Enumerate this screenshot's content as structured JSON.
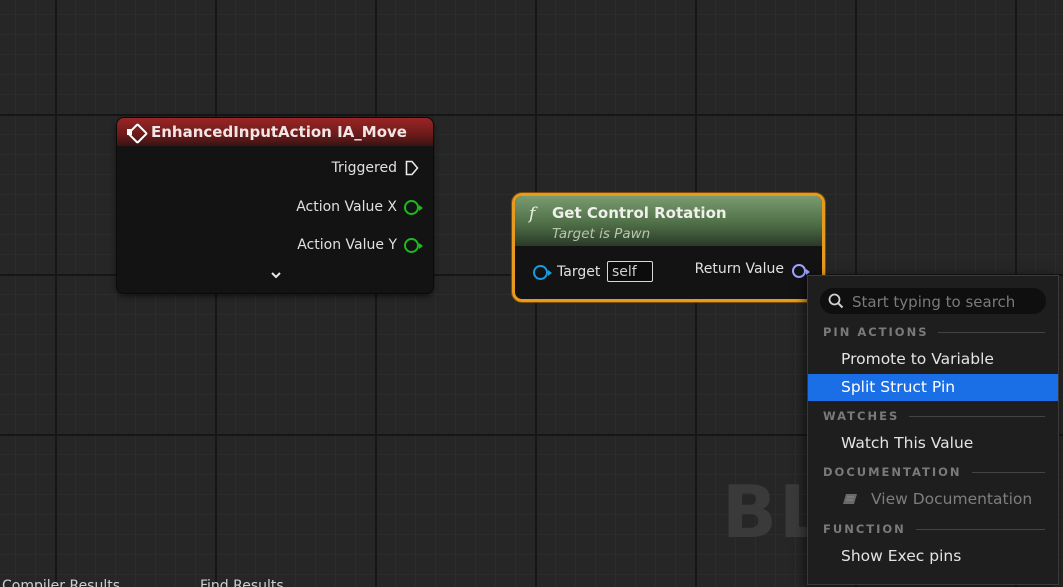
{
  "watermark": "BL",
  "node_input": {
    "title": "EnhancedInputAction IA_Move",
    "pins": [
      "Triggered",
      "Action Value X",
      "Action Value Y"
    ]
  },
  "node_fn": {
    "icon": "f",
    "title": "Get Control Rotation",
    "subtitle": "Target is Pawn",
    "target_label": "Target",
    "target_value": "self",
    "return_label": "Return Value"
  },
  "menu": {
    "search_placeholder": "Start typing to search",
    "sections": {
      "pin_actions": "PIN ACTIONS",
      "watches": "WATCHES",
      "documentation": "DOCUMENTATION",
      "function": "FUNCTION"
    },
    "items": {
      "promote": "Promote to Variable",
      "split": "Split Struct Pin",
      "watch": "Watch This Value",
      "view_doc": "View Documentation",
      "show_exec": "Show Exec pins"
    }
  },
  "bottom_tabs": [
    "Compiler Results",
    "Find Results"
  ],
  "colors": {
    "accent": "#1a6fe6",
    "node_selected_border": "#e89a1e",
    "exec_header": "#9a2525",
    "pure_fn_header": "#4f6f48",
    "float_pin": "#1fb91f",
    "object_pin": "#1a9ce0",
    "struct_pin": "#9aa4ff"
  }
}
